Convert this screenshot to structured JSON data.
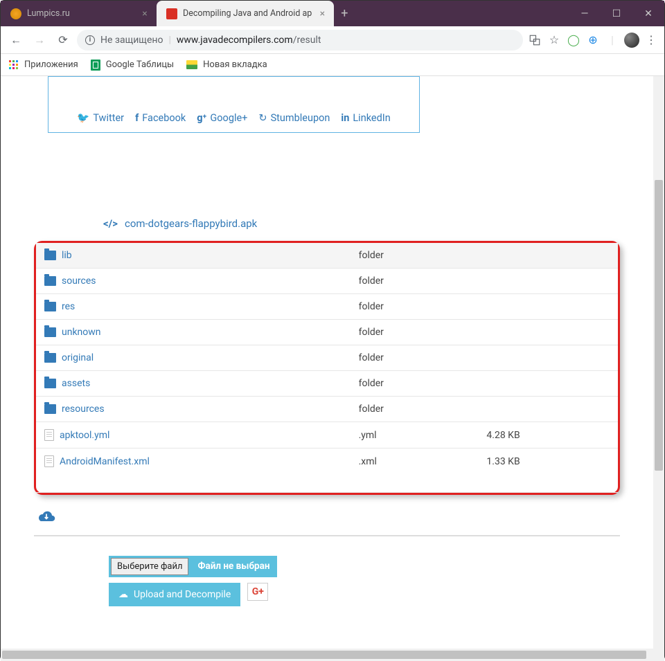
{
  "window": {
    "tabs": [
      {
        "title": "Lumpics.ru",
        "favicon": "#f5a623",
        "active": false
      },
      {
        "title": "Decompiling Java and Android ap",
        "favicon": "#d93025",
        "active": true
      }
    ],
    "url_insecure": "Не защищено",
    "url_host": "www.javadecompilers.com",
    "url_path": "/result"
  },
  "bookmarks": {
    "apps": "Приложения",
    "sheets": "Google Таблицы",
    "newtab": "Новая вкладка"
  },
  "content": {
    "socials": [
      "Twitter",
      "Facebook",
      "Google+",
      "Stumbleupon",
      "LinkedIn"
    ],
    "breadcrumb": "com-dotgears-flappybird.apk",
    "files": [
      {
        "name": "lib",
        "type": "folder",
        "size": ""
      },
      {
        "name": "sources",
        "type": "folder",
        "size": ""
      },
      {
        "name": "res",
        "type": "folder",
        "size": ""
      },
      {
        "name": "unknown",
        "type": "folder",
        "size": ""
      },
      {
        "name": "original",
        "type": "folder",
        "size": ""
      },
      {
        "name": "assets",
        "type": "folder",
        "size": ""
      },
      {
        "name": "resources",
        "type": "folder",
        "size": ""
      },
      {
        "name": "apktool.yml",
        "type": ".yml",
        "size": "4.28 KB"
      },
      {
        "name": "AndroidManifest.xml",
        "type": ".xml",
        "size": "1.33 KB"
      }
    ],
    "upload": {
      "choose_btn": "Выберите файл",
      "no_file": "Файл не выбран",
      "decompile_btn": "Upload and Decompile",
      "gplus": "G+"
    }
  }
}
